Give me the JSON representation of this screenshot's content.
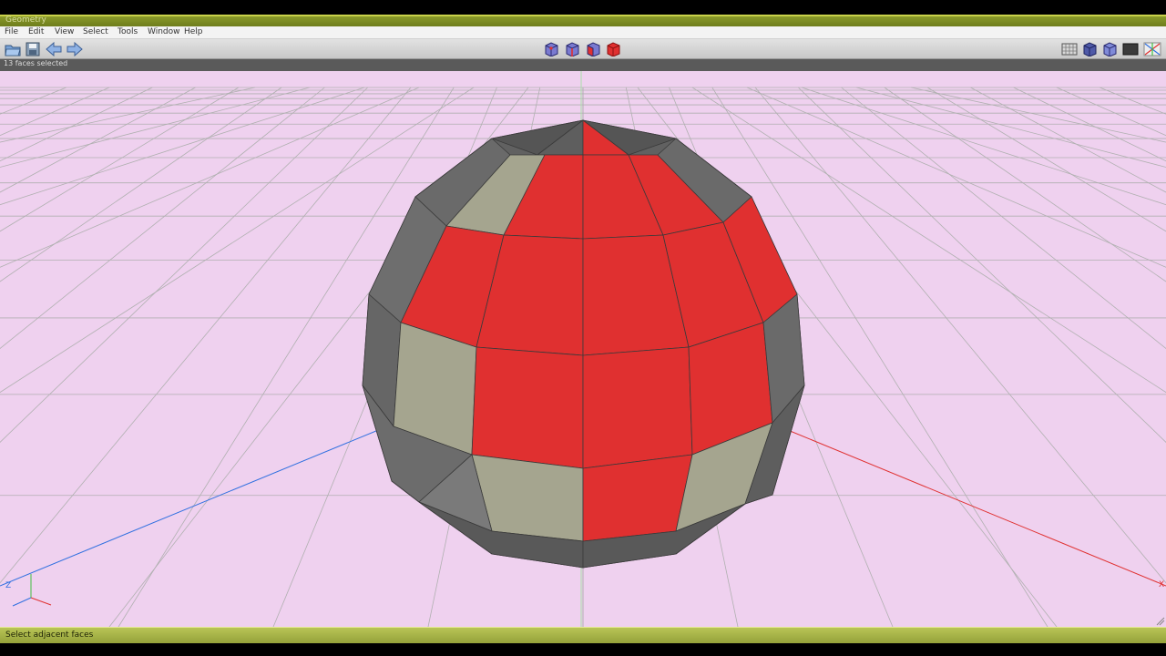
{
  "window": {
    "title": "Geometry"
  },
  "menu": [
    "File",
    "Edit",
    "View",
    "Select",
    "Tools",
    "Window",
    "Help"
  ],
  "toolbar": {
    "left": [
      {
        "name": "open-file-button",
        "icon": "folder-icon"
      },
      {
        "name": "save-button",
        "icon": "save-icon"
      },
      {
        "name": "undo-button",
        "icon": "arrow-left-icon"
      },
      {
        "name": "redo-button",
        "icon": "arrow-right-icon"
      }
    ],
    "center": [
      {
        "name": "vertex-select-mode-button",
        "icon": "cube-vertex-icon"
      },
      {
        "name": "edge-select-mode-button",
        "icon": "cube-edge-icon"
      },
      {
        "name": "face-select-mode-button",
        "icon": "cube-face-icon"
      },
      {
        "name": "body-select-mode-button",
        "icon": "cube-body-icon"
      }
    ],
    "right": [
      {
        "name": "toggle-grid-button",
        "icon": "grid-icon"
      },
      {
        "name": "shaded-view-button",
        "icon": "shaded-cube-icon"
      },
      {
        "name": "smooth-view-button",
        "icon": "smooth-cube-icon"
      },
      {
        "name": "background-view-button",
        "icon": "dark-square-icon"
      },
      {
        "name": "axes-view-button",
        "icon": "axes-icon"
      }
    ]
  },
  "info": {
    "selection_text": "13 faces selected"
  },
  "status": {
    "message": "Select adjacent faces"
  },
  "viewport": {
    "axis_labels": {
      "x": "X",
      "z": "Z"
    },
    "colors": {
      "background": "#efd1ef",
      "grid": "#b0b0b0",
      "selected_face": "#e03030",
      "unselected_face_light": "#a5a58f",
      "unselected_face_dark": "#6e6e6e",
      "x_axis": "#e03030",
      "y_axis": "#40c040",
      "z_axis": "#3070e0"
    }
  }
}
